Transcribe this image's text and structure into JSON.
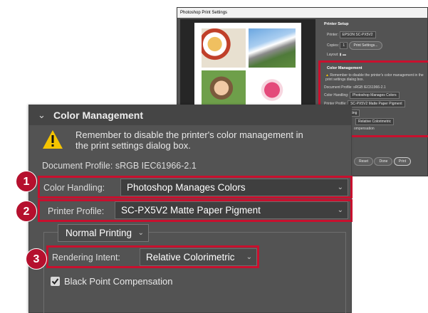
{
  "background_dialog": {
    "title": "Photoshop Print Settings",
    "printer_setup_heading": "Printer Setup",
    "printer_label": "Printer:",
    "printer_value": "EPSON SC-PX5V2",
    "copies_label": "Copies:",
    "copies_value": "1",
    "print_settings_button": "Print Settings...",
    "layout_label": "Layout:",
    "color_management_heading": "Color Management",
    "warning_text": "Remember to disable the printer's color management in the print settings dialog box.",
    "document_profile": "Document Profile: sRGB IEC61966-2.1",
    "color_handling_label": "Color Handling:",
    "color_handling_value": "Photoshop Manages Colors",
    "printer_profile_label": "Printer Profile:",
    "printer_profile_value": "SC-PX5V2 Matte Paper Pigment",
    "normal_printing": "Normal Printing",
    "rendering_intent_value": "Relative Colorimetric",
    "bpc_fragment": "ompensation",
    "reset_button": "Reset",
    "done_button": "Done",
    "print_button": "Print"
  },
  "panel": {
    "title": "Color Management",
    "warning_text": "Remember to disable the printer's color management in the print settings dialog box.",
    "document_profile": "Document Profile: sRGB IEC61966-2.1",
    "color_handling": {
      "label": "Color Handling:",
      "value": "Photoshop Manages Colors"
    },
    "printer_profile": {
      "label": "Printer Profile:",
      "value": "SC-PX5V2 Matte Paper Pigment"
    },
    "print_mode": {
      "value": "Normal Printing"
    },
    "rendering_intent": {
      "label": "Rendering Intent:",
      "value": "Relative Colorimetric"
    },
    "black_point_compensation": {
      "label": "Black Point Compensation",
      "checked": true
    }
  },
  "callouts": [
    "1",
    "2",
    "3"
  ],
  "colors": {
    "highlight": "#c8102e",
    "badge": "#b5102e",
    "panel_bg": "#535353",
    "warning": "#f5c400"
  },
  "icons": [
    "chevron-down-icon",
    "warning-icon",
    "checkmark-icon",
    "dropdown-caret-icon"
  ]
}
